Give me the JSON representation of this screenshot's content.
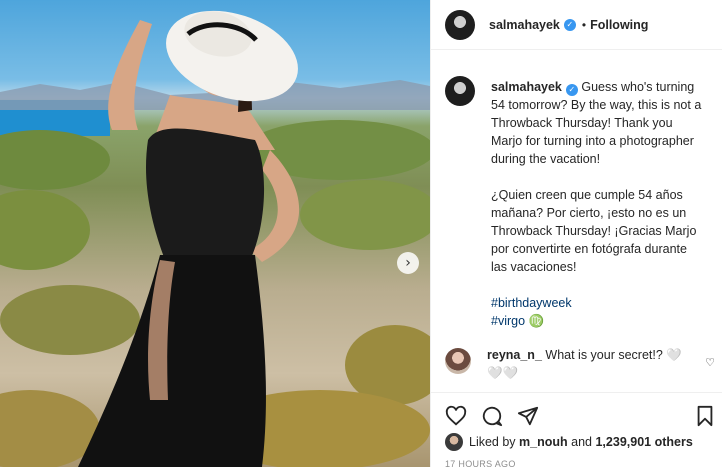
{
  "post": {
    "author": "salmahayek",
    "follow_status": "Following",
    "separator": "•",
    "caption_en": "Guess who's turning 54 tomorrow? By the way, this is not a Throwback Thursday! Thank you Marjo for turning into a photographer during the vacation!",
    "caption_es": "¿Quien creen que cumple 54 años mañana? Por cierto, ¡esto no es un Throwback Thursday! ¡Gracias Marjo por convertirte en fotógrafa durante las vacaciones!",
    "hashtags": [
      "#birthdayweek",
      "#virgo ♍"
    ]
  },
  "comment": {
    "user": "reyna_n_",
    "text": "What is your secret!? 🤍 🤍🤍"
  },
  "likes": {
    "prefix": "Liked by",
    "user": "m_nouh",
    "middle": "and",
    "count": "1,239,901 others"
  },
  "timestamp": "17 HOURS AGO",
  "icons": {
    "verified": "✓",
    "next": "›",
    "heart_small": "♡"
  },
  "colors": {
    "verified": "#3897f0",
    "hashtag": "#00376b",
    "text": "#262626",
    "muted": "#8e8e8e"
  }
}
